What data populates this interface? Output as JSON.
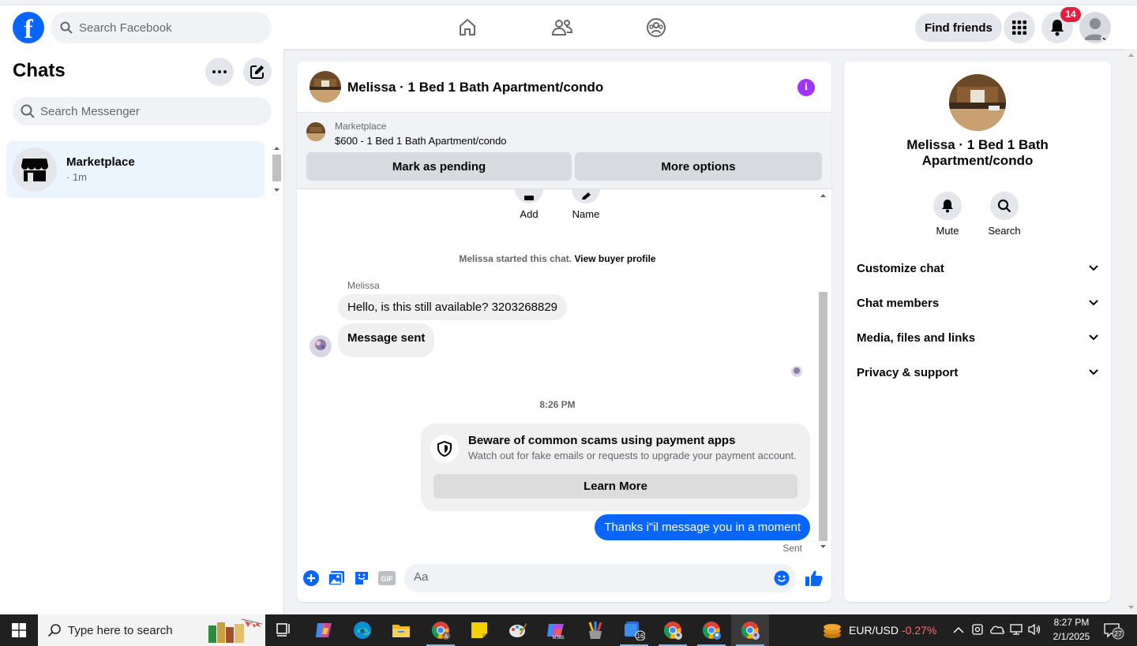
{
  "topbar": {
    "logo": "f",
    "search_placeholder": "Search Facebook",
    "find_friends": "Find friends",
    "notification_count": "14"
  },
  "left": {
    "title": "Chats",
    "search_placeholder": "Search Messenger",
    "chat_items": [
      {
        "name": "Marketplace",
        "time": "· 1m"
      }
    ]
  },
  "conversation": {
    "title": "Melissa · 1 Bed 1 Bath Apartment/condo",
    "info": "i",
    "marketplace_label": "Marketplace",
    "listing": "$600 - 1 Bed 1 Bath Apartment/condo",
    "mark_pending": "Mark as pending",
    "more_options": "More options",
    "mini_actions": [
      "Add",
      "Name"
    ],
    "started_text": "Melissa started this chat.",
    "view_buyer_profile": "View buyer profile",
    "sender_name": "Melissa",
    "incoming": [
      "Hello, is this still available? 3203268829",
      "Message sent"
    ],
    "timestamp": "8:26 PM",
    "scam_title": "Beware of common scams using payment apps",
    "scam_desc": "Watch out for fake emails or requests to upgrade your payment account.",
    "learn_more": "Learn More",
    "outgoing": "Thanks i\"il message you in a moment",
    "sent_status": "Sent",
    "composer_placeholder": "Aa",
    "gif": "GIF"
  },
  "right": {
    "name": "Melissa · 1 Bed 1 Bath Apartment/condo",
    "mute": "Mute",
    "search": "Search",
    "sections": [
      "Customize chat",
      "Chat members",
      "Media, files and links",
      "Privacy & support"
    ]
  },
  "taskbar": {
    "search_placeholder": "Type here to search",
    "badge_count": "16",
    "ticker": "EUR/USD",
    "ticker_change": "-0.27%",
    "time": "8:27 PM",
    "date": "2/1/2025",
    "notif_count": "27"
  },
  "colors": {
    "brand": "#0866ff",
    "info": "#a033ff",
    "badge": "#e41e3f",
    "ticker_negative": "#ff6b6b"
  }
}
